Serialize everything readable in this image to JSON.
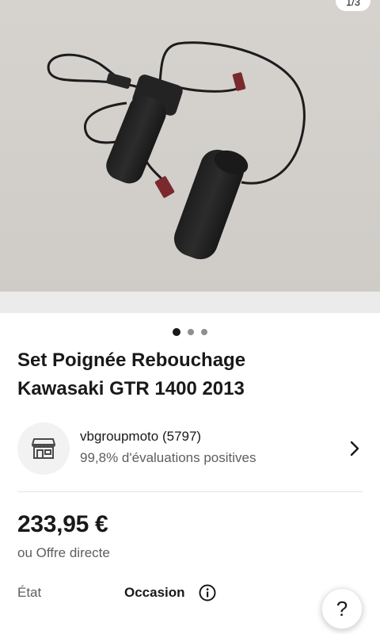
{
  "gallery": {
    "counter": "1/3",
    "image_count": 3,
    "active_index": 0
  },
  "listing": {
    "title_line1": "Set Poignée Rebouchage",
    "title_line2": "Kawasaki GTR 1400 2013"
  },
  "seller": {
    "name": "vbgroupmoto (5797)",
    "feedback": "99,8% d'évaluations positives",
    "avatar_icon": "store-icon"
  },
  "pricing": {
    "price": "233,95 €",
    "offer": "ou Offre directe"
  },
  "condition": {
    "label": "État",
    "value": "Occasion"
  },
  "help": {
    "label": "?"
  },
  "colors": {
    "text": "#191919",
    "secondary_text": "#5e5e5e",
    "gallery_background": "#ebebeb"
  }
}
